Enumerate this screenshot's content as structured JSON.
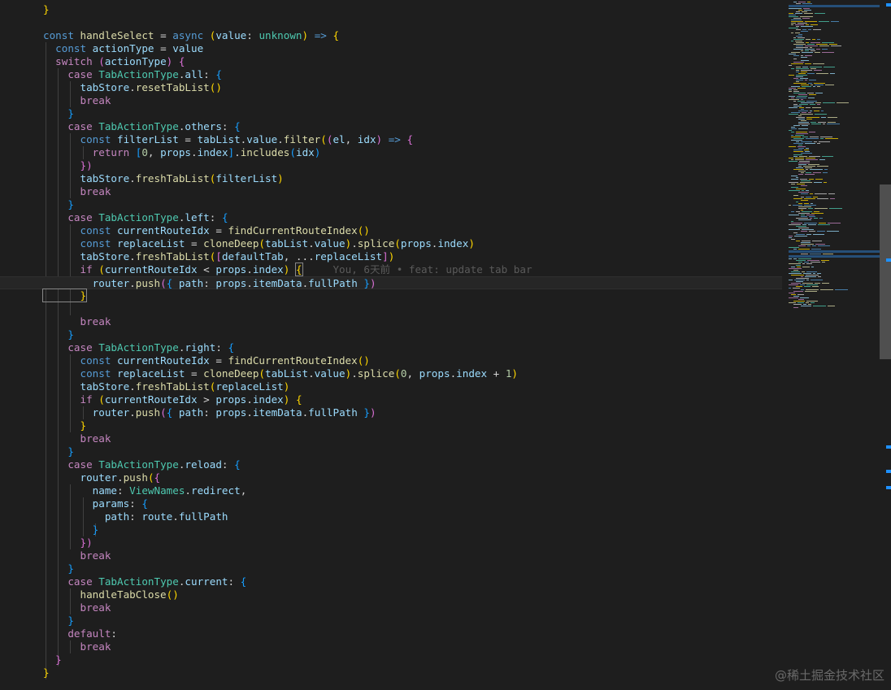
{
  "code": {
    "current_line_index": 21,
    "blame_text": "You, 6天前 • feat: update tab bar",
    "lines": [
      [
        {
          "t": "}",
          "c": "b1"
        }
      ],
      [],
      [
        {
          "t": "const ",
          "c": "k"
        },
        {
          "t": "handleSelect",
          "c": "f"
        },
        {
          "t": " = ",
          "c": "p"
        },
        {
          "t": "async ",
          "c": "k"
        },
        {
          "t": "(",
          "c": "b1"
        },
        {
          "t": "value",
          "c": "v"
        },
        {
          "t": ": ",
          "c": "p"
        },
        {
          "t": "unknown",
          "c": "t"
        },
        {
          "t": ") ",
          "c": "b1"
        },
        {
          "t": "=> ",
          "c": "k"
        },
        {
          "t": "{",
          "c": "b1"
        }
      ],
      [
        {
          "t": "  const ",
          "c": "k"
        },
        {
          "t": "actionType",
          "c": "v"
        },
        {
          "t": " = ",
          "c": "p"
        },
        {
          "t": "value",
          "c": "v"
        }
      ],
      [
        {
          "t": "  switch ",
          "c": "kc"
        },
        {
          "t": "(",
          "c": "b2"
        },
        {
          "t": "actionType",
          "c": "v"
        },
        {
          "t": ") ",
          "c": "b2"
        },
        {
          "t": "{",
          "c": "b2"
        }
      ],
      [
        {
          "t": "    case ",
          "c": "kc"
        },
        {
          "t": "TabActionType",
          "c": "t"
        },
        {
          "t": ".",
          "c": "p"
        },
        {
          "t": "all",
          "c": "v"
        },
        {
          "t": ": ",
          "c": "p"
        },
        {
          "t": "{",
          "c": "b3"
        }
      ],
      [
        {
          "t": "      tabStore",
          "c": "v"
        },
        {
          "t": ".",
          "c": "p"
        },
        {
          "t": "resetTabList",
          "c": "f"
        },
        {
          "t": "()",
          "c": "b1"
        }
      ],
      [
        {
          "t": "      break",
          "c": "kc"
        }
      ],
      [
        {
          "t": "    }",
          "c": "b3"
        }
      ],
      [
        {
          "t": "    case ",
          "c": "kc"
        },
        {
          "t": "TabActionType",
          "c": "t"
        },
        {
          "t": ".",
          "c": "p"
        },
        {
          "t": "others",
          "c": "v"
        },
        {
          "t": ": ",
          "c": "p"
        },
        {
          "t": "{",
          "c": "b3"
        }
      ],
      [
        {
          "t": "      const ",
          "c": "k"
        },
        {
          "t": "filterList",
          "c": "v"
        },
        {
          "t": " = ",
          "c": "p"
        },
        {
          "t": "tabList",
          "c": "v"
        },
        {
          "t": ".",
          "c": "p"
        },
        {
          "t": "value",
          "c": "v"
        },
        {
          "t": ".",
          "c": "p"
        },
        {
          "t": "filter",
          "c": "f"
        },
        {
          "t": "(",
          "c": "b1"
        },
        {
          "t": "(",
          "c": "b2"
        },
        {
          "t": "el",
          "c": "v"
        },
        {
          "t": ", ",
          "c": "p"
        },
        {
          "t": "idx",
          "c": "v"
        },
        {
          "t": ") ",
          "c": "b2"
        },
        {
          "t": "=> ",
          "c": "k"
        },
        {
          "t": "{",
          "c": "b2"
        }
      ],
      [
        {
          "t": "        return ",
          "c": "kc"
        },
        {
          "t": "[",
          "c": "b3"
        },
        {
          "t": "0",
          "c": "n"
        },
        {
          "t": ", ",
          "c": "p"
        },
        {
          "t": "props",
          "c": "v"
        },
        {
          "t": ".",
          "c": "p"
        },
        {
          "t": "index",
          "c": "v"
        },
        {
          "t": "]",
          "c": "b3"
        },
        {
          "t": ".",
          "c": "p"
        },
        {
          "t": "includes",
          "c": "f"
        },
        {
          "t": "(",
          "c": "b3"
        },
        {
          "t": "idx",
          "c": "v"
        },
        {
          "t": ")",
          "c": "b3"
        }
      ],
      [
        {
          "t": "      })",
          "c": "b2"
        }
      ],
      [
        {
          "t": "      tabStore",
          "c": "v"
        },
        {
          "t": ".",
          "c": "p"
        },
        {
          "t": "freshTabList",
          "c": "f"
        },
        {
          "t": "(",
          "c": "b1"
        },
        {
          "t": "filterList",
          "c": "v"
        },
        {
          "t": ")",
          "c": "b1"
        }
      ],
      [
        {
          "t": "      break",
          "c": "kc"
        }
      ],
      [
        {
          "t": "    }",
          "c": "b3"
        }
      ],
      [
        {
          "t": "    case ",
          "c": "kc"
        },
        {
          "t": "TabActionType",
          "c": "t"
        },
        {
          "t": ".",
          "c": "p"
        },
        {
          "t": "left",
          "c": "v"
        },
        {
          "t": ": ",
          "c": "p"
        },
        {
          "t": "{",
          "c": "b3"
        }
      ],
      [
        {
          "t": "      const ",
          "c": "k"
        },
        {
          "t": "currentRouteIdx",
          "c": "v"
        },
        {
          "t": " = ",
          "c": "p"
        },
        {
          "t": "findCurrentRouteIndex",
          "c": "f"
        },
        {
          "t": "()",
          "c": "b1"
        }
      ],
      [
        {
          "t": "      const ",
          "c": "k"
        },
        {
          "t": "replaceList",
          "c": "v"
        },
        {
          "t": " = ",
          "c": "p"
        },
        {
          "t": "cloneDeep",
          "c": "f"
        },
        {
          "t": "(",
          "c": "b1"
        },
        {
          "t": "tabList",
          "c": "v"
        },
        {
          "t": ".",
          "c": "p"
        },
        {
          "t": "value",
          "c": "v"
        },
        {
          "t": ")",
          "c": "b1"
        },
        {
          "t": ".",
          "c": "p"
        },
        {
          "t": "splice",
          "c": "f"
        },
        {
          "t": "(",
          "c": "b1"
        },
        {
          "t": "props",
          "c": "v"
        },
        {
          "t": ".",
          "c": "p"
        },
        {
          "t": "index",
          "c": "v"
        },
        {
          "t": ")",
          "c": "b1"
        }
      ],
      [
        {
          "t": "      tabStore",
          "c": "v"
        },
        {
          "t": ".",
          "c": "p"
        },
        {
          "t": "freshTabList",
          "c": "f"
        },
        {
          "t": "(",
          "c": "b1"
        },
        {
          "t": "[",
          "c": "b2"
        },
        {
          "t": "defaultTab",
          "c": "v"
        },
        {
          "t": ", ...",
          "c": "p"
        },
        {
          "t": "replaceList",
          "c": "v"
        },
        {
          "t": "]",
          "c": "b2"
        },
        {
          "t": ")",
          "c": "b1"
        }
      ],
      [
        {
          "t": "      if ",
          "c": "kc"
        },
        {
          "t": "(",
          "c": "b1"
        },
        {
          "t": "currentRouteIdx",
          "c": "v"
        },
        {
          "t": " < ",
          "c": "p"
        },
        {
          "t": "props",
          "c": "v"
        },
        {
          "t": ".",
          "c": "p"
        },
        {
          "t": "index",
          "c": "v"
        },
        {
          "t": ") ",
          "c": "b1"
        },
        {
          "t": "{",
          "c": "b1",
          "box": true
        },
        {
          "t": "     ",
          "c": "p"
        },
        {
          "t": "BLAME",
          "c": "blame"
        }
      ],
      [
        {
          "t": "        router",
          "c": "v"
        },
        {
          "t": ".",
          "c": "p"
        },
        {
          "t": "push",
          "c": "f"
        },
        {
          "t": "(",
          "c": "b2"
        },
        {
          "t": "{ ",
          "c": "b3"
        },
        {
          "t": "path",
          "c": "v"
        },
        {
          "t": ": ",
          "c": "p"
        },
        {
          "t": "props",
          "c": "v"
        },
        {
          "t": ".",
          "c": "p"
        },
        {
          "t": "itemData",
          "c": "v"
        },
        {
          "t": ".",
          "c": "p"
        },
        {
          "t": "fullPath",
          "c": "v"
        },
        {
          "t": " }",
          "c": "b3"
        },
        {
          "t": ")",
          "c": "b2"
        }
      ],
      [
        {
          "t": "      }",
          "c": "b1",
          "box": true
        }
      ],
      [],
      [
        {
          "t": "      break",
          "c": "kc"
        }
      ],
      [
        {
          "t": "    }",
          "c": "b3"
        }
      ],
      [
        {
          "t": "    case ",
          "c": "kc"
        },
        {
          "t": "TabActionType",
          "c": "t"
        },
        {
          "t": ".",
          "c": "p"
        },
        {
          "t": "right",
          "c": "v"
        },
        {
          "t": ": ",
          "c": "p"
        },
        {
          "t": "{",
          "c": "b3"
        }
      ],
      [
        {
          "t": "      const ",
          "c": "k"
        },
        {
          "t": "currentRouteIdx",
          "c": "v"
        },
        {
          "t": " = ",
          "c": "p"
        },
        {
          "t": "findCurrentRouteIndex",
          "c": "f"
        },
        {
          "t": "()",
          "c": "b1"
        }
      ],
      [
        {
          "t": "      const ",
          "c": "k"
        },
        {
          "t": "replaceList",
          "c": "v"
        },
        {
          "t": " = ",
          "c": "p"
        },
        {
          "t": "cloneDeep",
          "c": "f"
        },
        {
          "t": "(",
          "c": "b1"
        },
        {
          "t": "tabList",
          "c": "v"
        },
        {
          "t": ".",
          "c": "p"
        },
        {
          "t": "value",
          "c": "v"
        },
        {
          "t": ")",
          "c": "b1"
        },
        {
          "t": ".",
          "c": "p"
        },
        {
          "t": "splice",
          "c": "f"
        },
        {
          "t": "(",
          "c": "b1"
        },
        {
          "t": "0",
          "c": "n"
        },
        {
          "t": ", ",
          "c": "p"
        },
        {
          "t": "props",
          "c": "v"
        },
        {
          "t": ".",
          "c": "p"
        },
        {
          "t": "index",
          "c": "v"
        },
        {
          "t": " + ",
          "c": "p"
        },
        {
          "t": "1",
          "c": "n"
        },
        {
          "t": ")",
          "c": "b1"
        }
      ],
      [
        {
          "t": "      tabStore",
          "c": "v"
        },
        {
          "t": ".",
          "c": "p"
        },
        {
          "t": "freshTabList",
          "c": "f"
        },
        {
          "t": "(",
          "c": "b1"
        },
        {
          "t": "replaceList",
          "c": "v"
        },
        {
          "t": ")",
          "c": "b1"
        }
      ],
      [
        {
          "t": "      if ",
          "c": "kc"
        },
        {
          "t": "(",
          "c": "b1"
        },
        {
          "t": "currentRouteIdx",
          "c": "v"
        },
        {
          "t": " > ",
          "c": "p"
        },
        {
          "t": "props",
          "c": "v"
        },
        {
          "t": ".",
          "c": "p"
        },
        {
          "t": "index",
          "c": "v"
        },
        {
          "t": ") ",
          "c": "b1"
        },
        {
          "t": "{",
          "c": "b1"
        }
      ],
      [
        {
          "t": "        router",
          "c": "v"
        },
        {
          "t": ".",
          "c": "p"
        },
        {
          "t": "push",
          "c": "f"
        },
        {
          "t": "(",
          "c": "b2"
        },
        {
          "t": "{ ",
          "c": "b3"
        },
        {
          "t": "path",
          "c": "v"
        },
        {
          "t": ": ",
          "c": "p"
        },
        {
          "t": "props",
          "c": "v"
        },
        {
          "t": ".",
          "c": "p"
        },
        {
          "t": "itemData",
          "c": "v"
        },
        {
          "t": ".",
          "c": "p"
        },
        {
          "t": "fullPath",
          "c": "v"
        },
        {
          "t": " }",
          "c": "b3"
        },
        {
          "t": ")",
          "c": "b2"
        }
      ],
      [
        {
          "t": "      }",
          "c": "b1"
        }
      ],
      [
        {
          "t": "      break",
          "c": "kc"
        }
      ],
      [
        {
          "t": "    }",
          "c": "b3"
        }
      ],
      [
        {
          "t": "    case ",
          "c": "kc"
        },
        {
          "t": "TabActionType",
          "c": "t"
        },
        {
          "t": ".",
          "c": "p"
        },
        {
          "t": "reload",
          "c": "v"
        },
        {
          "t": ": ",
          "c": "p"
        },
        {
          "t": "{",
          "c": "b3"
        }
      ],
      [
        {
          "t": "      router",
          "c": "v"
        },
        {
          "t": ".",
          "c": "p"
        },
        {
          "t": "push",
          "c": "f"
        },
        {
          "t": "(",
          "c": "b1"
        },
        {
          "t": "{",
          "c": "b2"
        }
      ],
      [
        {
          "t": "        name",
          "c": "v"
        },
        {
          "t": ": ",
          "c": "p"
        },
        {
          "t": "ViewNames",
          "c": "t"
        },
        {
          "t": ".",
          "c": "p"
        },
        {
          "t": "redirect",
          "c": "v"
        },
        {
          "t": ",",
          "c": "p"
        }
      ],
      [
        {
          "t": "        params",
          "c": "v"
        },
        {
          "t": ": ",
          "c": "p"
        },
        {
          "t": "{",
          "c": "b3"
        }
      ],
      [
        {
          "t": "          path",
          "c": "v"
        },
        {
          "t": ": ",
          "c": "p"
        },
        {
          "t": "route",
          "c": "v"
        },
        {
          "t": ".",
          "c": "p"
        },
        {
          "t": "fullPath",
          "c": "v"
        }
      ],
      [
        {
          "t": "        }",
          "c": "b3"
        }
      ],
      [
        {
          "t": "      })",
          "c": "b2"
        }
      ],
      [
        {
          "t": "      break",
          "c": "kc"
        }
      ],
      [
        {
          "t": "    }",
          "c": "b3"
        }
      ],
      [
        {
          "t": "    case ",
          "c": "kc"
        },
        {
          "t": "TabActionType",
          "c": "t"
        },
        {
          "t": ".",
          "c": "p"
        },
        {
          "t": "current",
          "c": "v"
        },
        {
          "t": ": ",
          "c": "p"
        },
        {
          "t": "{",
          "c": "b3"
        }
      ],
      [
        {
          "t": "      handleTabClose",
          "c": "f"
        },
        {
          "t": "()",
          "c": "b1"
        }
      ],
      [
        {
          "t": "      break",
          "c": "kc"
        }
      ],
      [
        {
          "t": "    }",
          "c": "b3"
        }
      ],
      [
        {
          "t": "    default",
          "c": "kc"
        },
        {
          "t": ":",
          "c": "p"
        }
      ],
      [
        {
          "t": "      break",
          "c": "kc"
        }
      ],
      [
        {
          "t": "  }",
          "c": "b2"
        }
      ],
      [
        {
          "t": "}",
          "c": "b1"
        }
      ]
    ]
  },
  "watermark": "@稀土掘金技术社区",
  "colors": {
    "background": "#1e1e1e",
    "keyword": "#569cd6",
    "control_keyword": "#c586c0",
    "function": "#dcdcaa",
    "variable": "#9cdcfe",
    "type": "#4ec9b0",
    "number": "#b5cea8",
    "bracket_1": "#ffd700",
    "bracket_2": "#da70d6",
    "bracket_3": "#179fff",
    "blame": "#5a5a5a"
  }
}
